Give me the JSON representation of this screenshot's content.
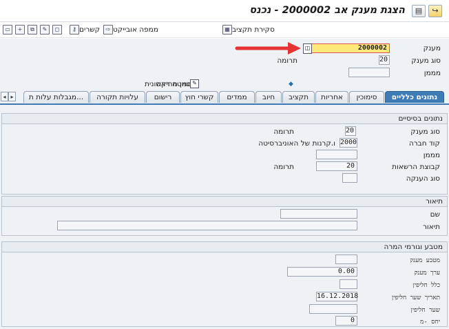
{
  "window": {
    "title": "הצגת מענק אב 2000002 - נכנס"
  },
  "toolbar": {
    "items": [
      {
        "label": "סקירת תקציב",
        "icon": "grid-icon"
      },
      {
        "label": "ממפה אובייקט",
        "icon": "object-mapper-icon"
      },
      {
        "label": "קשרים",
        "icon": "relations-icon"
      }
    ]
  },
  "header": {
    "grant_label": "מענק",
    "grant_value": "2000002",
    "grant_type_label": "סוג מענק",
    "grant_type_value": "20",
    "grant_type_text": "תרומה",
    "funder_label": "מממן",
    "funder_value": "",
    "delete_flag_label": "סמן מחיקה",
    "draft_label": "טיוטה ראשונית"
  },
  "tabs": [
    {
      "label": "נתונים כלליים",
      "active": true
    },
    {
      "label": "סימוכין"
    },
    {
      "label": "אחריות"
    },
    {
      "label": "תקציב"
    },
    {
      "label": "חיוב"
    },
    {
      "label": "ממדים"
    },
    {
      "label": "קשרי חוץ"
    },
    {
      "label": "רישום"
    },
    {
      "label": "עלויות תקורה"
    },
    {
      "label": "מגבלות עלות ת..."
    }
  ],
  "basic_data": {
    "title": "נתונים בסיסיים",
    "grant_type_label": "סוג מענק",
    "grant_type_value": "20",
    "grant_type_text": "תרומה",
    "company_code_label": "קוד חברה",
    "company_code_value": "2000",
    "company_code_text": "ו.קרנות של האוניברסיטה",
    "funder_label": "מממן",
    "funder_value": "",
    "auth_group_label": "קבוצת הרשאות",
    "auth_group_value": "20",
    "auth_group_text": "תרומה",
    "award_type_label": "סוג הענקה",
    "award_type_value": ""
  },
  "description": {
    "title": "תיאור",
    "name_label": "שם",
    "name_value": "",
    "desc_label": "תיאור",
    "desc_value": ""
  },
  "currency": {
    "title": "מטבע וגורמי המרה",
    "grant_currency_label": "מטבע מענק",
    "grant_currency_value": "",
    "grant_value_label": "ערך מענק",
    "grant_value_value": "0.00",
    "exchange_rule_label": "כלל חליפין",
    "exchange_rule_value": "",
    "exchange_date_label": "תאריך שער חליפין",
    "exchange_date_value": "16.12.2018",
    "exchange_rate_label": "שער חליפין",
    "exchange_rate_value": "",
    "ratio_label": "יחס -מ",
    "ratio_value": "0"
  }
}
